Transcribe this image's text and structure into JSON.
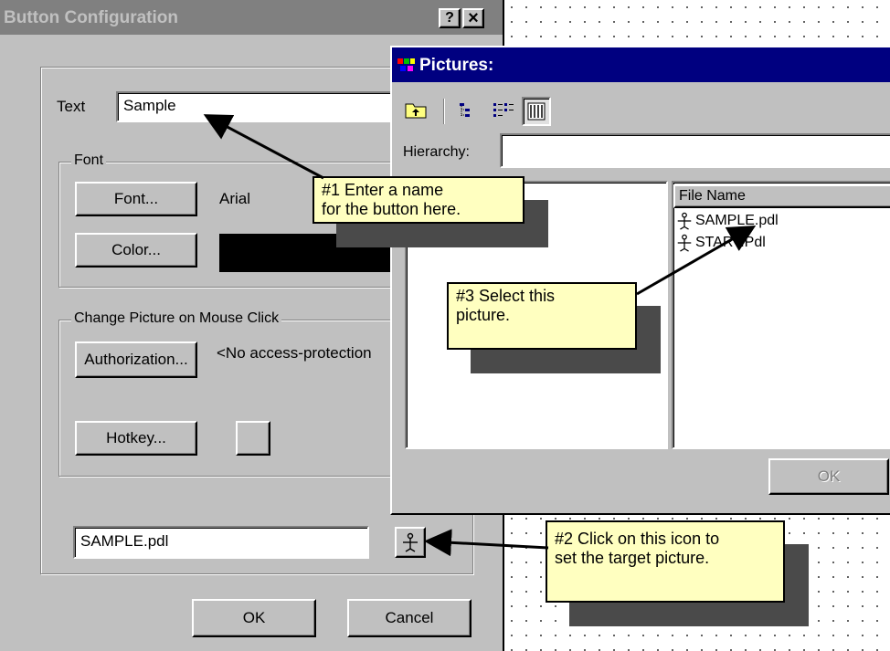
{
  "colors": {
    "title_active": "#000080",
    "title_inactive": "#808080",
    "face": "#c0c0c0",
    "callout": "#ffffc0"
  },
  "button_config": {
    "title": "Button Configuration",
    "help_label": "?",
    "close_label": "×",
    "text_label": "Text",
    "text_value": "Sample",
    "font_group": "Font",
    "font_button": "Font...",
    "font_value": "Arial",
    "color_button": "Color...",
    "change_group": "Change Picture on Mouse Click",
    "authorization_button": "Authorization...",
    "authorization_value": "<No access-protection",
    "hotkey_button": "Hotkey...",
    "picture_field": "SAMPLE.pdl",
    "ok_button": "OK",
    "cancel_button": "Cancel"
  },
  "pictures": {
    "title": "Pictures:",
    "hierarchy_label": "Hierarchy:",
    "hierarchy_value": "",
    "file_column": "File Name",
    "files": [
      "SAMPLE.pdl",
      "START.Pdl"
    ],
    "ok_button": "OK"
  },
  "callouts": {
    "one": [
      "#1 Enter a name",
      "for the button here."
    ],
    "two": [
      "#2 Click on this icon to",
      "set the target picture."
    ],
    "three": [
      "#3 Select this",
      "picture."
    ]
  },
  "icons": [
    "help-icon",
    "close-icon",
    "app-icon",
    "folder-up-icon",
    "tree-view-icon",
    "list-view-icon",
    "detail-view-icon",
    "picture-file-icon",
    "browse-picture-icon"
  ]
}
